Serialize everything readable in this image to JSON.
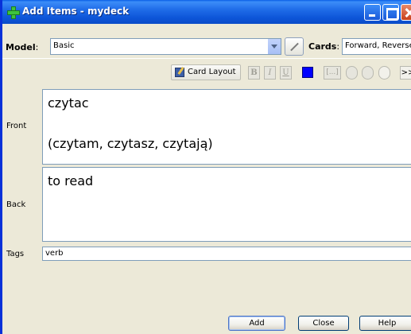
{
  "window": {
    "title": "Add Items - mydeck"
  },
  "model_row": {
    "model_label": "Model",
    "model_value": "Basic",
    "cards_label": "Cards",
    "cards_value": "Forward, Reverse"
  },
  "toolbar": {
    "card_layout_label": "Card Layout",
    "bold_label": "B",
    "italic_label": "I",
    "underline_label": "U",
    "text_color": "#0000FF",
    "cloze_label": "[...]",
    "more_label": ">>"
  },
  "fields": {
    "front": {
      "label": "Front",
      "line1": "czytac",
      "line2": "(czytam, czytasz, czytają)"
    },
    "back": {
      "label": "Back",
      "line1": "to read"
    },
    "tags": {
      "label": "Tags",
      "value": "verb"
    }
  },
  "buttons": {
    "add": "Add",
    "close": "Close",
    "help": "Help"
  }
}
